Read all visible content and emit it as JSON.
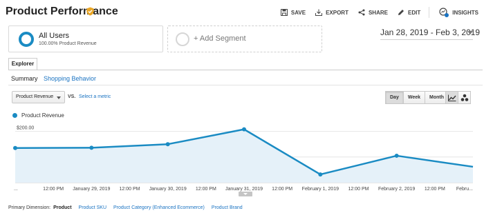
{
  "header": {
    "title": "Product Performance",
    "actions": [
      {
        "label": "SAVE",
        "icon": "save-icon"
      },
      {
        "label": "EXPORT",
        "icon": "export-icon"
      },
      {
        "label": "SHARE",
        "icon": "share-icon"
      },
      {
        "label": "EDIT",
        "icon": "edit-icon"
      },
      {
        "label": "INSIGHTS",
        "icon": "insights-icon"
      }
    ]
  },
  "segments": {
    "active": {
      "name": "All Users",
      "subtitle": "100.00% Product Revenue"
    },
    "add_label": "+ Add Segment"
  },
  "date_range": "Jan 28, 2019 - Feb 3, 2019",
  "tabs": {
    "explorer": "Explorer",
    "subtabs": [
      "Summary",
      "Shopping Behavior"
    ]
  },
  "metric_row": {
    "metric": "Product Revenue",
    "vs": "VS.",
    "select_metric": "Select a metric",
    "periods": [
      "Day",
      "Week",
      "Month"
    ],
    "active_period": "Day"
  },
  "colors": {
    "series": "#1a8bc3",
    "fill": "#e5f1f9",
    "link": "#1a73c2"
  },
  "chart_data": {
    "type": "line",
    "legend": [
      "Product Revenue"
    ],
    "series": [
      {
        "name": "Product Revenue",
        "x": [
          "Jan 28, 2019",
          "January 29, 2019",
          "January 30, 2019",
          "January 31, 2019",
          "February 1, 2019",
          "February 2, 2019",
          "February 3, 2019"
        ],
        "values": [
          135,
          136,
          150,
          208,
          32,
          105,
          62
        ]
      }
    ],
    "y_ticks": [
      {
        "label": "$200.00",
        "value": 200
      },
      {
        "label": "$100.00",
        "value": 100
      }
    ],
    "x_tick_labels": [
      "...",
      "12:00 PM",
      "January 29, 2019",
      "12:00 PM",
      "January 30, 2019",
      "12:00 PM",
      "January 31, 2019",
      "12:00 PM",
      "February 1, 2019",
      "12:00 PM",
      "February 2, 2019",
      "12:00 PM",
      "Febru..."
    ],
    "ylim": [
      0,
      250
    ],
    "area_fill": true
  },
  "primary_dimension": {
    "label": "Primary Dimension:",
    "options": [
      "Product",
      "Product SKU",
      "Product Category (Enhanced Ecommerce)",
      "Product Brand"
    ],
    "active": "Product"
  }
}
